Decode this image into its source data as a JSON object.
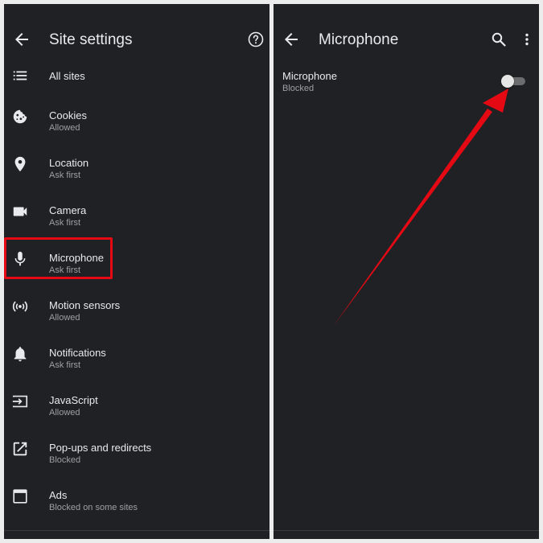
{
  "left_panel": {
    "title": "Site settings",
    "back_icon": "arrow-back-icon",
    "help_icon": "help-icon",
    "items": [
      {
        "label": "All sites",
        "sub": "",
        "icon": "list-icon"
      },
      {
        "label": "Cookies",
        "sub": "Allowed",
        "icon": "cookie-icon"
      },
      {
        "label": "Location",
        "sub": "Ask first",
        "icon": "location-pin-icon"
      },
      {
        "label": "Camera",
        "sub": "Ask first",
        "icon": "videocam-icon"
      },
      {
        "label": "Microphone",
        "sub": "Ask first",
        "icon": "microphone-icon"
      },
      {
        "label": "Motion sensors",
        "sub": "Allowed",
        "icon": "sensors-icon"
      },
      {
        "label": "Notifications",
        "sub": "Ask first",
        "icon": "bell-icon"
      },
      {
        "label": "JavaScript",
        "sub": "Allowed",
        "icon": "javascript-icon"
      },
      {
        "label": "Pop-ups and redirects",
        "sub": "Blocked",
        "icon": "open-in-new-icon"
      },
      {
        "label": "Ads",
        "sub": "Blocked on some sites",
        "icon": "ads-icon"
      }
    ],
    "highlighted_item": "Microphone"
  },
  "right_panel": {
    "title": "Microphone",
    "back_icon": "arrow-back-icon",
    "search_icon": "search-icon",
    "more_icon": "more-vert-icon",
    "setting": {
      "label": "Microphone",
      "sub": "Blocked",
      "toggle_on": false
    }
  },
  "colors": {
    "panel_bg": "#202124",
    "highlight_border": "#e50914",
    "arrow": "#e50914"
  }
}
